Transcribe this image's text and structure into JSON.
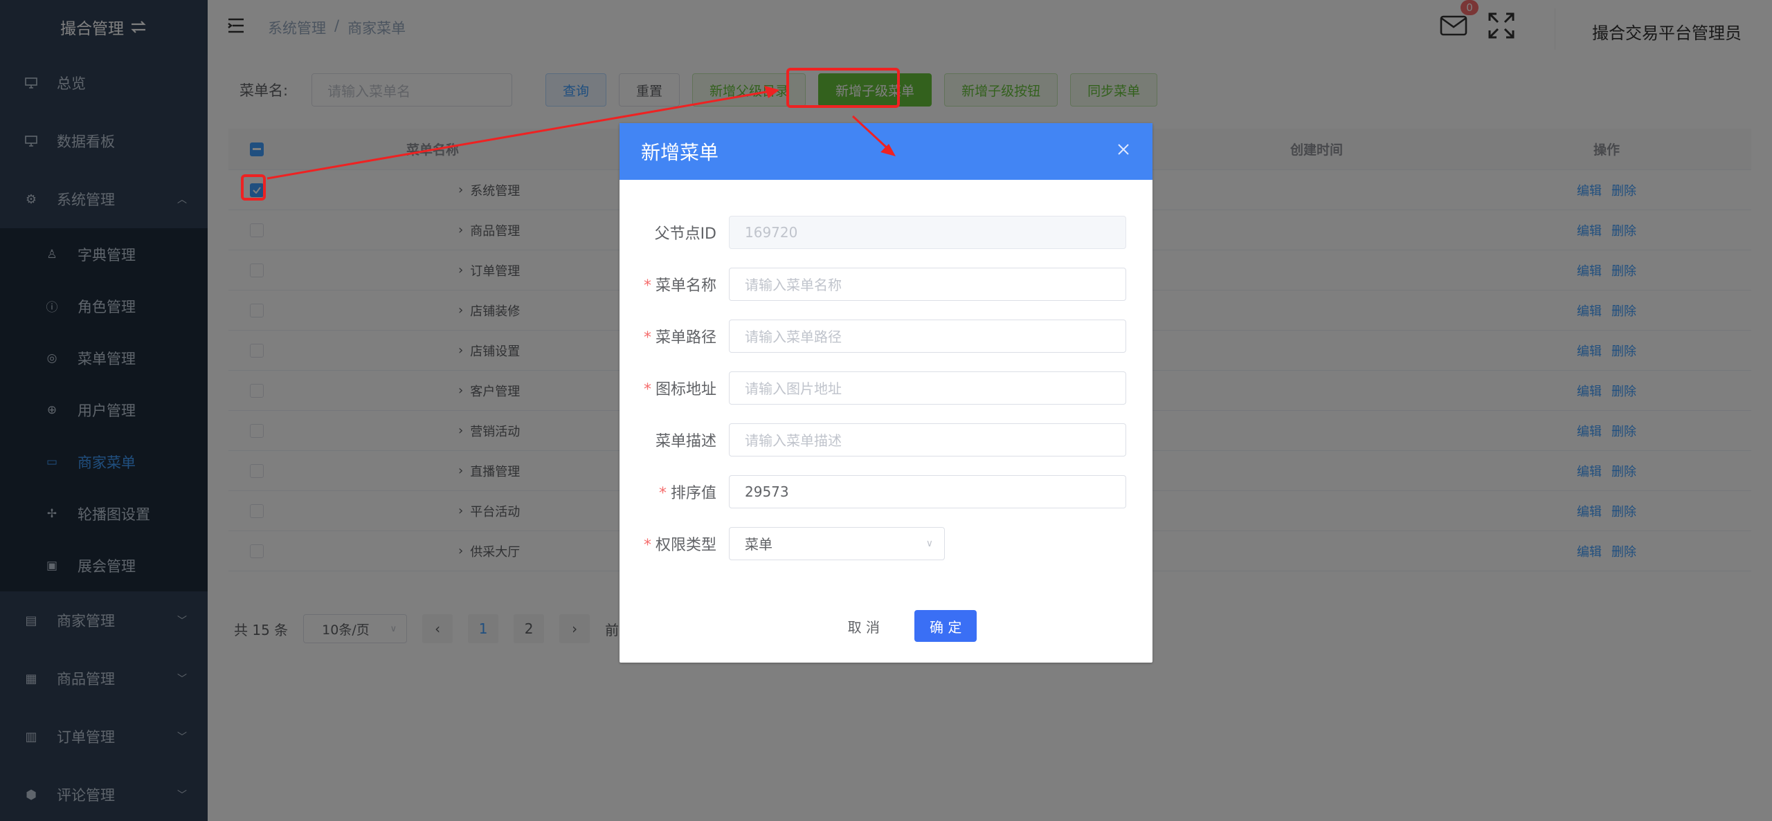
{
  "sidebar": {
    "logo_text": "撮合管理",
    "items": [
      {
        "label": "总览",
        "icon": "monitor-icon"
      },
      {
        "label": "数据看板",
        "icon": "monitor-icon"
      },
      {
        "label": "系统管理",
        "icon": "gear-icon"
      }
    ],
    "sub_items": [
      {
        "label": "字典管理",
        "icon": "user-icon"
      },
      {
        "label": "角色管理",
        "icon": "info-icon"
      },
      {
        "label": "菜单管理",
        "icon": "location-icon"
      },
      {
        "label": "用户管理",
        "icon": "zoom-icon"
      },
      {
        "label": "商家菜单",
        "icon": "box-icon"
      },
      {
        "label": "轮播图设置",
        "icon": "move-icon"
      },
      {
        "label": "展会管理",
        "icon": "tile-icon"
      }
    ],
    "bottom_items": [
      {
        "label": "商家管理",
        "icon": "wallet-icon"
      },
      {
        "label": "商品管理",
        "icon": "gift-icon"
      },
      {
        "label": "订单管理",
        "icon": "document-icon"
      },
      {
        "label": "评论管理",
        "icon": "shield-icon"
      }
    ]
  },
  "header": {
    "breadcrumb": [
      "系统管理",
      "商家菜单"
    ],
    "separator": "/",
    "badge_count": "0",
    "admin_name": "撮合交易平台管理员"
  },
  "filter": {
    "label": "菜单名:",
    "placeholder": "请输入菜单名",
    "buttons": [
      "查询",
      "重置",
      "新增父级目录",
      "新增子级菜单",
      "新增子级按钮",
      "同步菜单"
    ]
  },
  "table": {
    "headers": [
      "菜单名称",
      "创建时间",
      "操作"
    ],
    "rows": [
      "系统管理",
      "商品管理",
      "订单管理",
      "店铺装修",
      "店铺设置",
      "客户管理",
      "营销活动",
      "直播管理",
      "平台活动",
      "供采大厅"
    ],
    "edit_label": "编辑",
    "delete_label": "删除"
  },
  "pager": {
    "total": "共 15 条",
    "page_size": "10条/页",
    "pages": [
      "1",
      "2"
    ],
    "goto": "前往"
  },
  "dialog": {
    "title": "新增菜单",
    "fields": [
      {
        "label": "父节点ID",
        "required": false,
        "value": "169720",
        "placeholder": ""
      },
      {
        "label": "菜单名称",
        "required": true,
        "value": "",
        "placeholder": "请输入菜单名称"
      },
      {
        "label": "菜单路径",
        "required": true,
        "value": "",
        "placeholder": "请输入菜单路径"
      },
      {
        "label": "图标地址",
        "required": true,
        "value": "",
        "placeholder": "请输入图片地址"
      },
      {
        "label": "菜单描述",
        "required": false,
        "value": "",
        "placeholder": "请输入菜单描述"
      },
      {
        "label": "排序值",
        "required": true,
        "value": "29573",
        "placeholder": ""
      },
      {
        "label": "权限类型",
        "required": true,
        "value": "菜单",
        "placeholder": ""
      }
    ],
    "cancel": "取 消",
    "ok": "确 定"
  },
  "colors": {
    "sidebar_bg": "#304156",
    "submenu_bg": "#1f2d3d",
    "active": "#409eff",
    "dialog_header": "#4285f4",
    "annotation_red": "#ee2222"
  }
}
